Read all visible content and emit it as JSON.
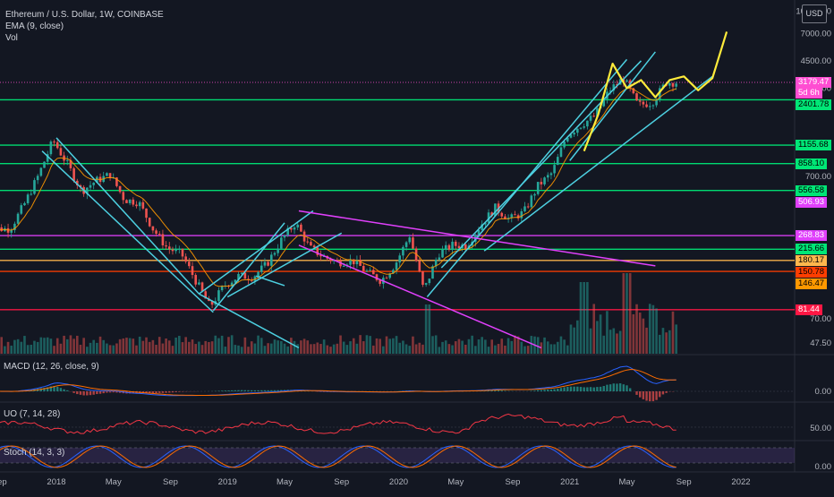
{
  "header": {
    "symbol": "Ethereum / U.S. Dollar, 1W, COINBASE",
    "ema": "EMA (9, close)",
    "vol": "Vol"
  },
  "currency": "USD",
  "scale": {
    "main_ticks": [
      {
        "label": "10000.00",
        "value": 10000
      },
      {
        "label": "7000.00",
        "value": 7000
      },
      {
        "label": "4500.00",
        "value": 4500
      },
      {
        "label": "2900.00",
        "value": 2900
      },
      {
        "label": "700.00",
        "value": 700
      },
      {
        "label": "70.00",
        "value": 70
      },
      {
        "label": "47.50",
        "value": 47.5
      }
    ],
    "macd_tick": "0.00",
    "uo_tick": "50.00",
    "stoch_tick": "0.00"
  },
  "levels": [
    {
      "label": "3179.47",
      "value": 3179.47,
      "bg": "#ff4dd2",
      "text": "white",
      "line": "#ff4dd2",
      "dotted": true
    },
    {
      "label": "2401.78",
      "value": 2401.78,
      "bg": "#00e676",
      "text": "dark",
      "line": "#00e676"
    },
    {
      "label": "1155.68",
      "value": 1155.68,
      "bg": "#00e676",
      "text": "dark",
      "line": "#00e676"
    },
    {
      "label": "858.10",
      "value": 858.1,
      "bg": "#00e676",
      "text": "dark",
      "line": "#00e676"
    },
    {
      "label": "556.58",
      "value": 556.58,
      "bg": "#00e676",
      "text": "dark",
      "line": "#00e676"
    },
    {
      "label": "506.93",
      "value": 506.93,
      "bg": "#e040fb",
      "text": "white",
      "line": null
    },
    {
      "label": "268.83",
      "value": 268.83,
      "bg": "#e040fb",
      "text": "white",
      "line": "#e040fb"
    },
    {
      "label": "215.66",
      "value": 215.66,
      "bg": "#00e676",
      "text": "dark",
      "line": "#00e676"
    },
    {
      "label": "180.17",
      "value": 180.17,
      "bg": "#ffb74d",
      "text": "dark",
      "line": "#ffb74d"
    },
    {
      "label": "150.78",
      "value": 150.78,
      "bg": "#ff3d00",
      "text": "dark",
      "line": "#ff3d00"
    },
    {
      "label": "146.47",
      "value": 146.47,
      "bg": "#ff9800",
      "text": "dark",
      "line": null
    },
    {
      "label": "81.44",
      "value": 81.44,
      "bg": "#ff1744",
      "text": "white",
      "line": "#ff1744"
    }
  ],
  "countdown": "5d 6h",
  "countdown_bg": "#ff4dd2",
  "panes": {
    "macd": "MACD (12, 26, close, 9)",
    "uo": "UO (7, 14, 28)",
    "stoch": "Stoch (14, 3, 3)"
  },
  "x_axis": [
    "Sep",
    "2018",
    "May",
    "Sep",
    "2019",
    "May",
    "Sep",
    "2020",
    "May",
    "Sep",
    "2021",
    "May",
    "Sep",
    "2022"
  ],
  "colors": {
    "bull": "#26a69a",
    "bear": "#ef5350",
    "channel": "#4dd0e1",
    "magenta_line": "#e040fb",
    "projection": "#ffeb3b",
    "background": "#131722"
  },
  "chart_data": {
    "type": "candlestick",
    "title": "Ethereum / U.S. Dollar, 1W, COINBASE",
    "interval": "1W",
    "scale": "log",
    "ylim": [
      40,
      12000
    ],
    "y_unit": "USD",
    "x_ticks": [
      "Sep",
      "2018",
      "May",
      "Sep",
      "2019",
      "May",
      "Sep",
      "2020",
      "May",
      "Sep",
      "2021",
      "May",
      "Sep",
      "2022"
    ],
    "price_path": [
      [
        "2017-08",
        300
      ],
      [
        "2017-10",
        300
      ],
      [
        "2017-11",
        450
      ],
      [
        "2017-12",
        720
      ],
      [
        "2018-01",
        1250
      ],
      [
        "2018-02",
        850
      ],
      [
        "2018-03",
        550
      ],
      [
        "2018-04",
        650
      ],
      [
        "2018-05",
        720
      ],
      [
        "2018-06",
        480
      ],
      [
        "2018-07",
        460
      ],
      [
        "2018-08",
        300
      ],
      [
        "2018-09",
        220
      ],
      [
        "2018-10",
        200
      ],
      [
        "2018-11",
        130
      ],
      [
        "2018-12",
        85
      ],
      [
        "2019-01",
        120
      ],
      [
        "2019-02",
        140
      ],
      [
        "2019-03",
        138
      ],
      [
        "2019-04",
        170
      ],
      [
        "2019-05",
        250
      ],
      [
        "2019-06",
        330
      ],
      [
        "2019-07",
        220
      ],
      [
        "2019-08",
        190
      ],
      [
        "2019-09",
        175
      ],
      [
        "2019-10",
        180
      ],
      [
        "2019-11",
        150
      ],
      [
        "2019-12",
        130
      ],
      [
        "2020-01",
        170
      ],
      [
        "2020-02",
        270
      ],
      [
        "2020-03",
        110
      ],
      [
        "2020-04",
        200
      ],
      [
        "2020-05",
        230
      ],
      [
        "2020-06",
        230
      ],
      [
        "2020-07",
        320
      ],
      [
        "2020-08",
        420
      ],
      [
        "2020-09",
        350
      ],
      [
        "2020-10",
        390
      ],
      [
        "2020-11",
        600
      ],
      [
        "2020-12",
        740
      ],
      [
        "2021-01",
        1350
      ],
      [
        "2021-02",
        1600
      ],
      [
        "2021-03",
        1850
      ],
      [
        "2021-04",
        2800
      ],
      [
        "2021-05",
        3400
      ],
      [
        "2021-06",
        2200
      ],
      [
        "2021-07",
        2300
      ],
      [
        "2021-08",
        3180
      ]
    ],
    "ema_period": 9,
    "volume_units": "relative",
    "macd": {
      "params": "12, 26, close, 9"
    },
    "uo": {
      "params": "7, 14, 28",
      "reference": 50
    },
    "stoch": {
      "params": "14, 3, 3"
    }
  }
}
